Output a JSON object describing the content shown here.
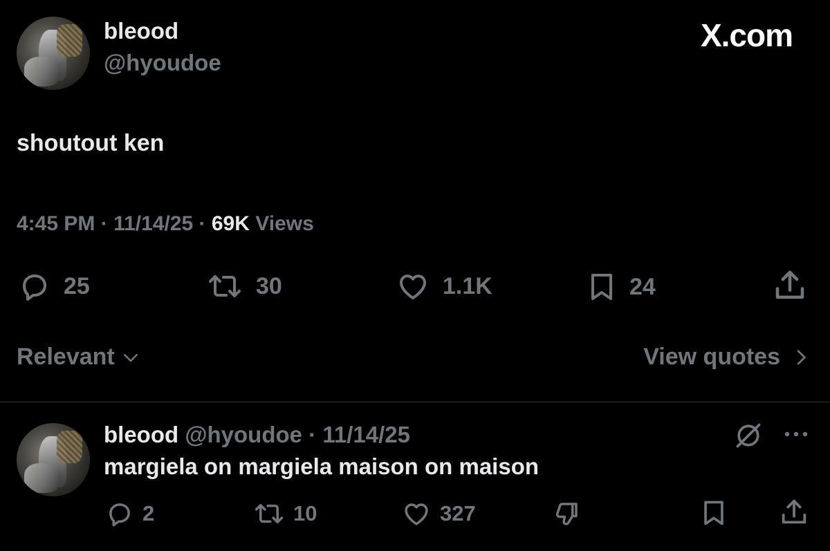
{
  "brand": {
    "text": "X.com"
  },
  "post": {
    "author_name": "bleood",
    "author_handle": "@hyoudoe",
    "text": "shoutout ken",
    "time": "4:45 PM",
    "sep1": " · ",
    "date": "11/14/25",
    "sep2": " · ",
    "views_count": "69K",
    "views_label": " Views",
    "stats": {
      "replies": "25",
      "reposts": "30",
      "likes": "1.1K",
      "bookmarks": "24"
    }
  },
  "replies_bar": {
    "sort_label": "Relevant",
    "view_quotes_label": "View quotes"
  },
  "reply": {
    "author_name": "bleood",
    "author_handle": "@hyoudoe",
    "sep": " · ",
    "date": "11/14/25",
    "text": "margiela on margiela maison on maison",
    "stats": {
      "replies": "2",
      "reposts": "10",
      "likes": "327"
    }
  },
  "icons": {
    "reply": "reply-icon",
    "repost": "repost-icon",
    "like": "heart-icon",
    "bookmark": "bookmark-icon",
    "share": "share-icon",
    "dislike": "dislike-icon",
    "grok": "grok-icon",
    "more": "more-icon",
    "chevron_down": "chevron-down-icon",
    "chevron_right": "chevron-right-icon"
  }
}
